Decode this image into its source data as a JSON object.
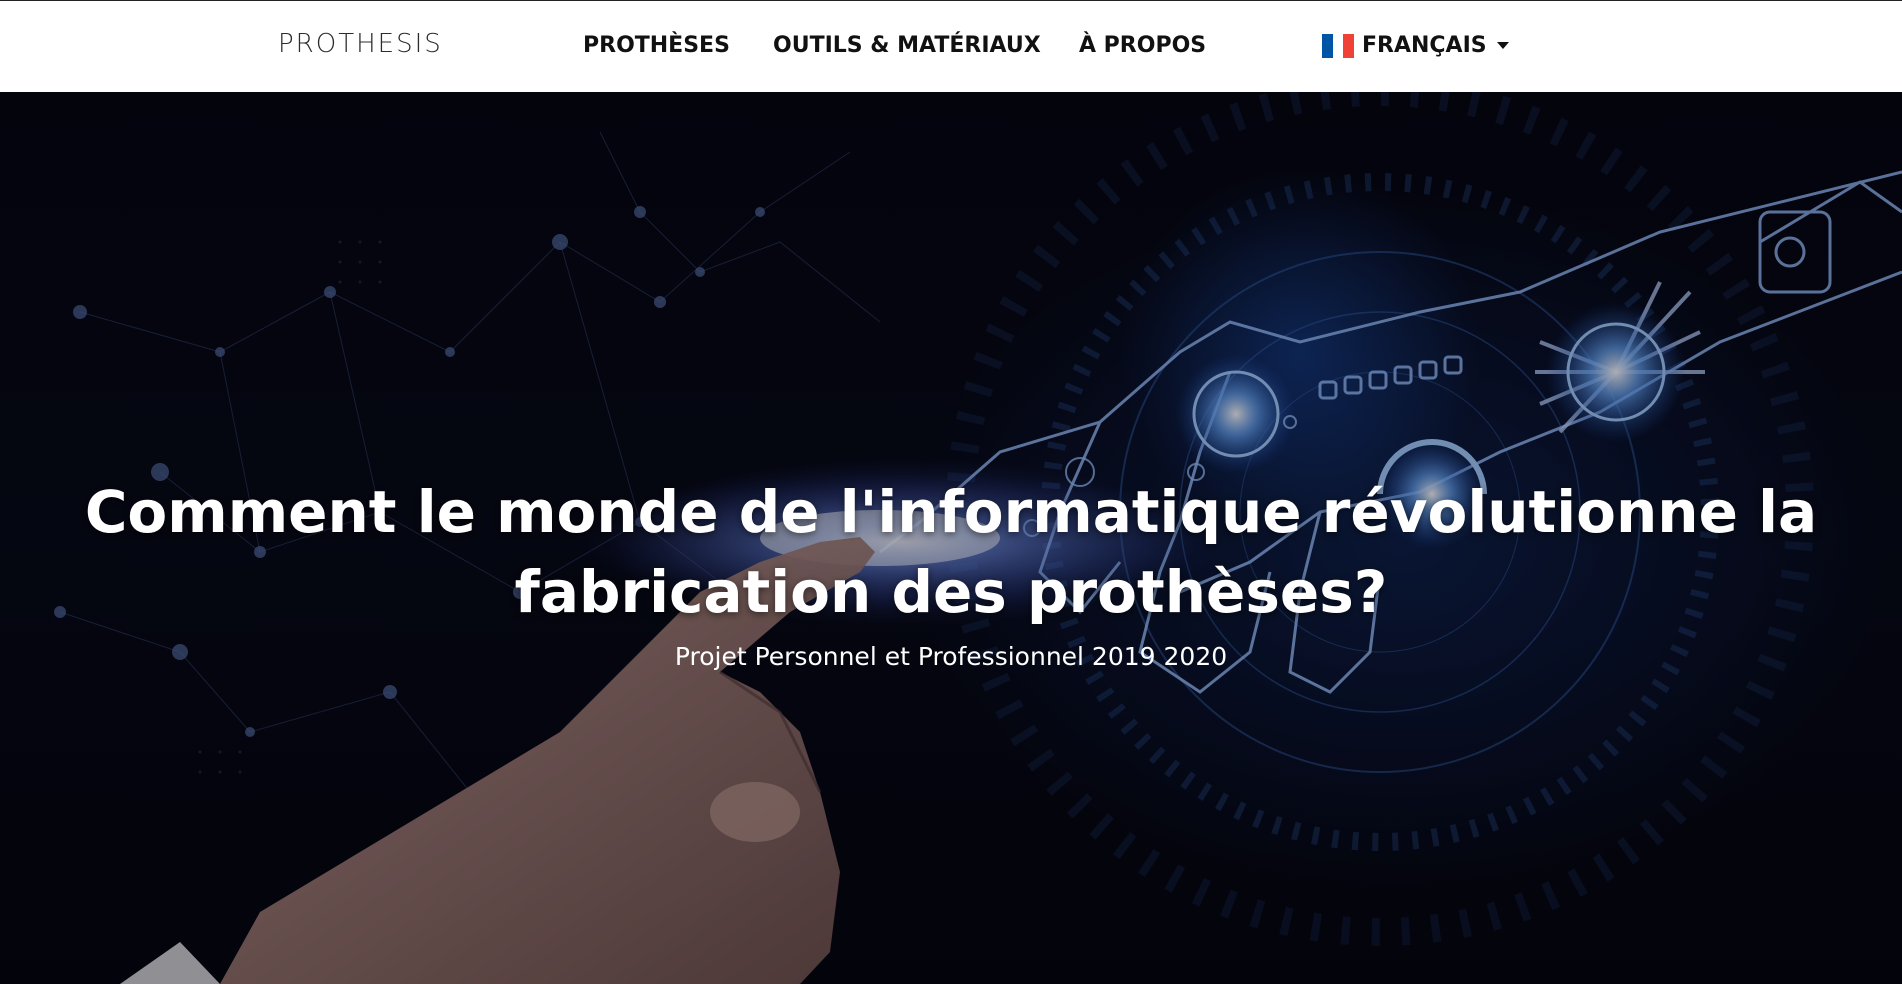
{
  "navbar": {
    "logo_text": "PROTHESIS",
    "links": [
      {
        "label": "PROTHÈSES"
      },
      {
        "label": "OUTILS & MATÉRIAUX"
      },
      {
        "label": "À PROPOS"
      }
    ],
    "language": {
      "label": "FRANÇAIS",
      "flag_icon": "france-flag-icon",
      "flag_colors": [
        "#0055A4",
        "#FFFFFF",
        "#EF4135"
      ]
    }
  },
  "hero": {
    "title_line1": "Comment le monde de l'informatique révolutionne la",
    "title_line2": "fabrication des prothèses?",
    "subtitle": "Projet Personnel et Professionnel 2019 2020",
    "image_description_icon": "robot-hand-touching-human-hand-image"
  },
  "colors": {
    "nav_background": "#ffffff",
    "nav_text": "#111111",
    "hero_text": "#ffffff",
    "accent_glow": "#4a7dff"
  }
}
